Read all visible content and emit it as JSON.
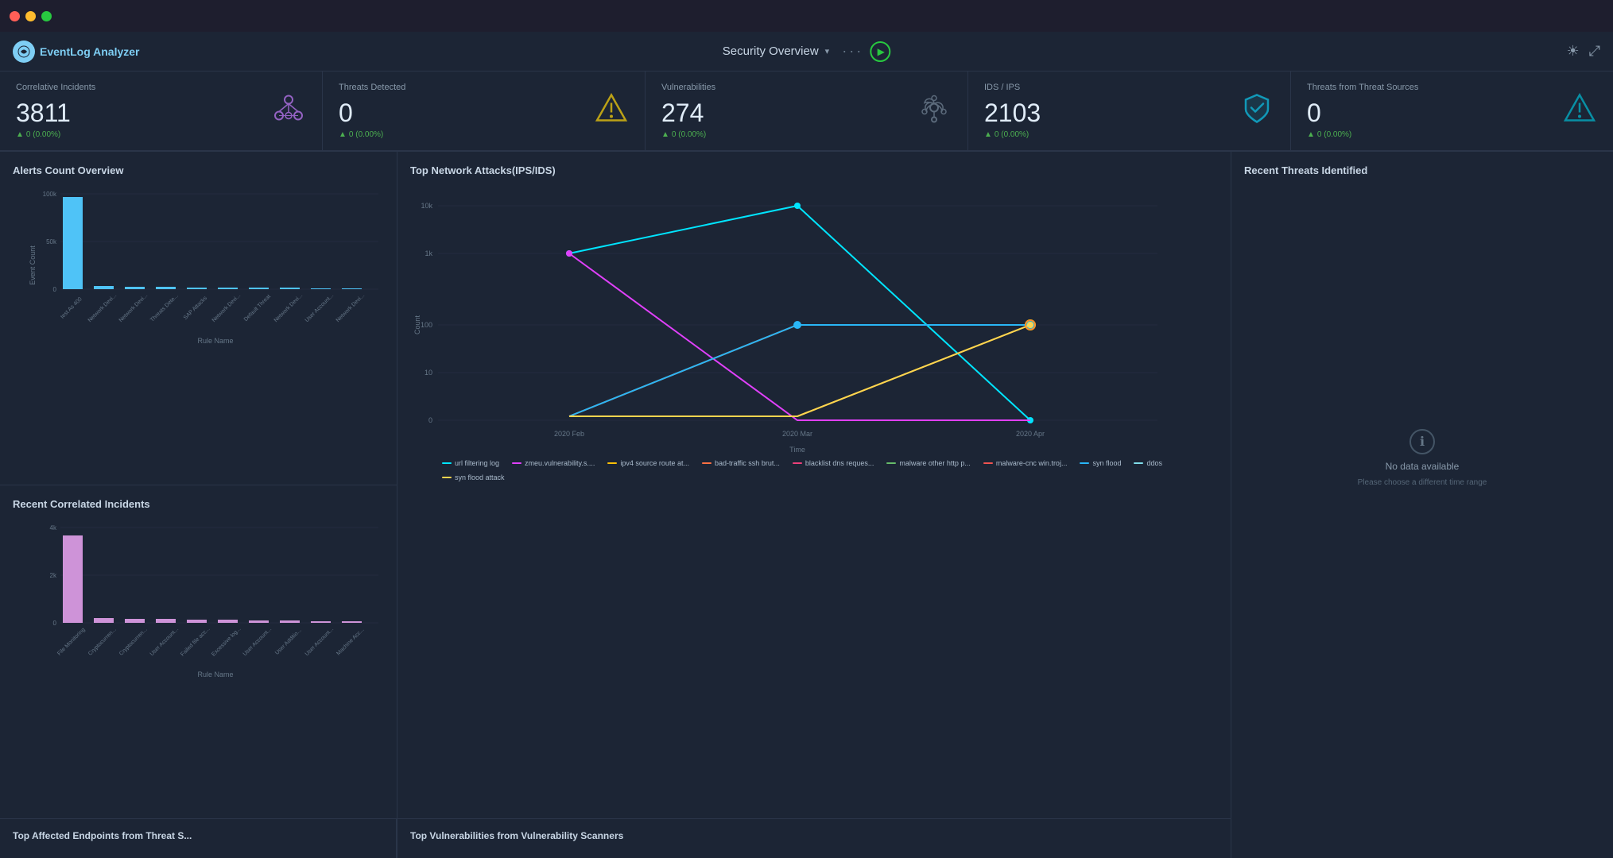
{
  "titleBar": {
    "trafficLights": [
      "red",
      "yellow",
      "green"
    ]
  },
  "menuBar": {
    "appName": "EventLog Analyzer",
    "centerTitle": "Security Overview",
    "dropdownArrow": "▾",
    "dots": "···",
    "themeIcon": "☀",
    "expandIcon": "⤢"
  },
  "stats": [
    {
      "label": "Correlative Incidents",
      "value": "3811",
      "change": "0 (0.00%)",
      "iconType": "network",
      "iconColor": "purple"
    },
    {
      "label": "Threats Detected",
      "value": "0",
      "change": "0 (0.00%)",
      "iconType": "warning",
      "iconColor": "yellow"
    },
    {
      "label": "Vulnerabilities",
      "value": "274",
      "change": "0 (0.00%)",
      "iconType": "biohazard",
      "iconColor": "gray"
    },
    {
      "label": "IDS / IPS",
      "value": "2103",
      "change": "0 (0.00%)",
      "iconType": "shield",
      "iconColor": "cyan"
    },
    {
      "label": "Threats from Threat Sources",
      "value": "0",
      "change": "0 (0.00%)",
      "iconType": "warning-outline",
      "iconColor": "cyan-outline"
    }
  ],
  "panels": {
    "alertsCount": {
      "title": "Alerts Count Overview",
      "yAxisLabel": "Event Count",
      "xAxisLabel": "Rule Name",
      "bars": [
        {
          "label": "test As 400",
          "value": 85000,
          "max": 100000,
          "color": "#4fc3f7"
        },
        {
          "label": "Network Devi...",
          "value": 1000,
          "max": 100000,
          "color": "#4fc3f7"
        },
        {
          "label": "Network Devi...",
          "value": 800,
          "max": 100000,
          "color": "#4fc3f7"
        },
        {
          "label": "Threats Dete...",
          "value": 600,
          "max": 100000,
          "color": "#4fc3f7"
        },
        {
          "label": "SAP Attacks",
          "value": 400,
          "max": 100000,
          "color": "#4fc3f7"
        },
        {
          "label": "Network Devi...",
          "value": 300,
          "max": 100000,
          "color": "#4fc3f7"
        },
        {
          "label": "Default Threat",
          "value": 200,
          "max": 100000,
          "color": "#4fc3f7"
        },
        {
          "label": "Network Devi...",
          "value": 150,
          "max": 100000,
          "color": "#4fc3f7"
        },
        {
          "label": "User Account...",
          "value": 100,
          "max": 100000,
          "color": "#4fc3f7"
        },
        {
          "label": "Network Devi...",
          "value": 80,
          "max": 100000,
          "color": "#4fc3f7"
        }
      ],
      "yTicks": [
        "100k",
        "50k",
        "0"
      ]
    },
    "recentCorrelated": {
      "title": "Recent Correlated Incidents",
      "yAxisLabel": "Event Count",
      "xAxisLabel": "Rule Name",
      "bars": [
        {
          "label": "File Monitoring",
          "value": 3500,
          "max": 4000,
          "color": "#ce93d8"
        },
        {
          "label": "Cryptocurren...",
          "value": 200,
          "max": 4000,
          "color": "#ce93d8"
        },
        {
          "label": "Cryptocurren...",
          "value": 180,
          "max": 4000,
          "color": "#ce93d8"
        },
        {
          "label": "User Account...",
          "value": 160,
          "max": 4000,
          "color": "#ce93d8"
        },
        {
          "label": "Failed file acc...",
          "value": 140,
          "max": 4000,
          "color": "#ce93d8"
        },
        {
          "label": "Excessive log...",
          "value": 120,
          "max": 4000,
          "color": "#ce93d8"
        },
        {
          "label": "User Account...",
          "value": 100,
          "max": 4000,
          "color": "#ce93d8"
        },
        {
          "label": "User Additio...",
          "value": 80,
          "max": 4000,
          "color": "#ce93d8"
        },
        {
          "label": "User Account...",
          "value": 60,
          "max": 4000,
          "color": "#ce93d8"
        },
        {
          "label": "Machine Acc...",
          "value": 40,
          "max": 4000,
          "color": "#ce93d8"
        }
      ],
      "yTicks": [
        "4k",
        "2k",
        "0"
      ]
    },
    "topNetworkAttacks": {
      "title": "Top Network Attacks(IPS/IDS)",
      "yAxisLabel": "Count",
      "xAxisLabel": "Time",
      "xTicks": [
        "2020 Feb",
        "2020 Mar",
        "2020 Apr"
      ],
      "yTicks": [
        "10k",
        "1k",
        "100",
        "10",
        "0"
      ],
      "legend": [
        {
          "label": "url filtering log",
          "color": "#00e5ff"
        },
        {
          "label": "zmeu.vulnerability.s....",
          "color": "#e040fb"
        },
        {
          "label": "ipv4 source route at...",
          "color": "#ffc107"
        },
        {
          "label": "bad-traffic ssh brut...",
          "color": "#ff7043"
        },
        {
          "label": "blacklist dns reques...",
          "color": "#ec407a"
        },
        {
          "label": "malware other http p...",
          "color": "#66bb6a"
        },
        {
          "label": "malware-cnc win.troj...",
          "color": "#ef5350"
        },
        {
          "label": "syn flood",
          "color": "#29b6f6"
        },
        {
          "label": "ddos",
          "color": "#80deea"
        },
        {
          "label": "syn flood attack",
          "color": "#ffd54f"
        }
      ]
    },
    "recentThreats": {
      "title": "Recent Threats Identified",
      "noData": "No data available",
      "noDataSub": "Please choose a different time range"
    },
    "topAffectedEndpoints": {
      "title": "Top Affected Endpoints from Threat S..."
    },
    "topVulnerabilities": {
      "title": "Top Vulnerabilities from Vulnerability Scanners"
    }
  }
}
